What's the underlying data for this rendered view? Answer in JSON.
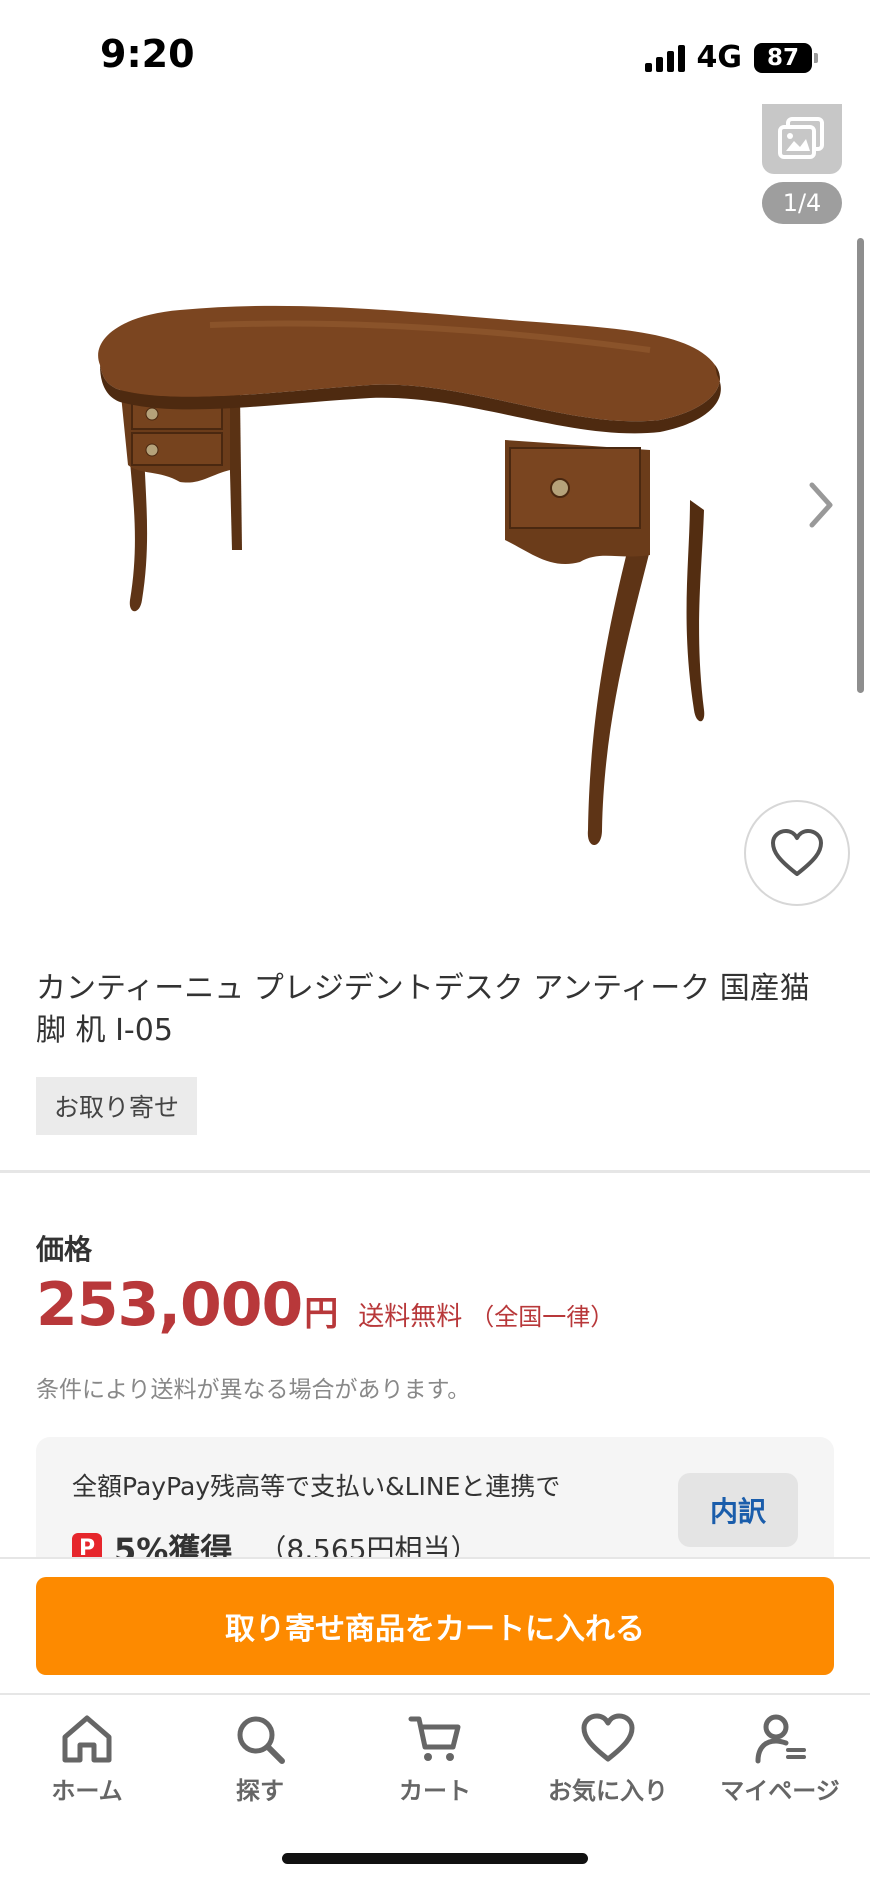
{
  "status_bar": {
    "time": "9:20",
    "network": "4G",
    "battery": "87"
  },
  "gallery": {
    "page_indicator": "1/4"
  },
  "product": {
    "title": "カンティーニュ プレジデントデスク アンティーク 国産猫脚 机 I-05",
    "stock_badge": "お取り寄せ"
  },
  "price": {
    "heading": "価格",
    "value": "253,000",
    "unit": "円",
    "shipping_free": "送料無料",
    "shipping_note": "（全国一律）",
    "condition_note": "条件により送料が異なる場合があります。"
  },
  "paypay": {
    "text": "全額PayPay残高等で支払い&LINEと連携で",
    "icon_letter": "P",
    "earn": "5%獲得",
    "equivalent": "（8,565円相当）",
    "breakdown_label": "内訳"
  },
  "cart": {
    "button_label": "取り寄せ商品をカートに入れる"
  },
  "nav": {
    "items": [
      {
        "label": "ホーム",
        "icon": "home-icon"
      },
      {
        "label": "探す",
        "icon": "search-icon"
      },
      {
        "label": "カート",
        "icon": "cart-icon"
      },
      {
        "label": "お気に入り",
        "icon": "heart-icon"
      },
      {
        "label": "マイページ",
        "icon": "user-icon"
      }
    ]
  },
  "colors": {
    "price": "#b8383a",
    "cart_button": "#fd8a00",
    "breakdown_text": "#1a5dab",
    "paypay_red": "#e6262c"
  }
}
